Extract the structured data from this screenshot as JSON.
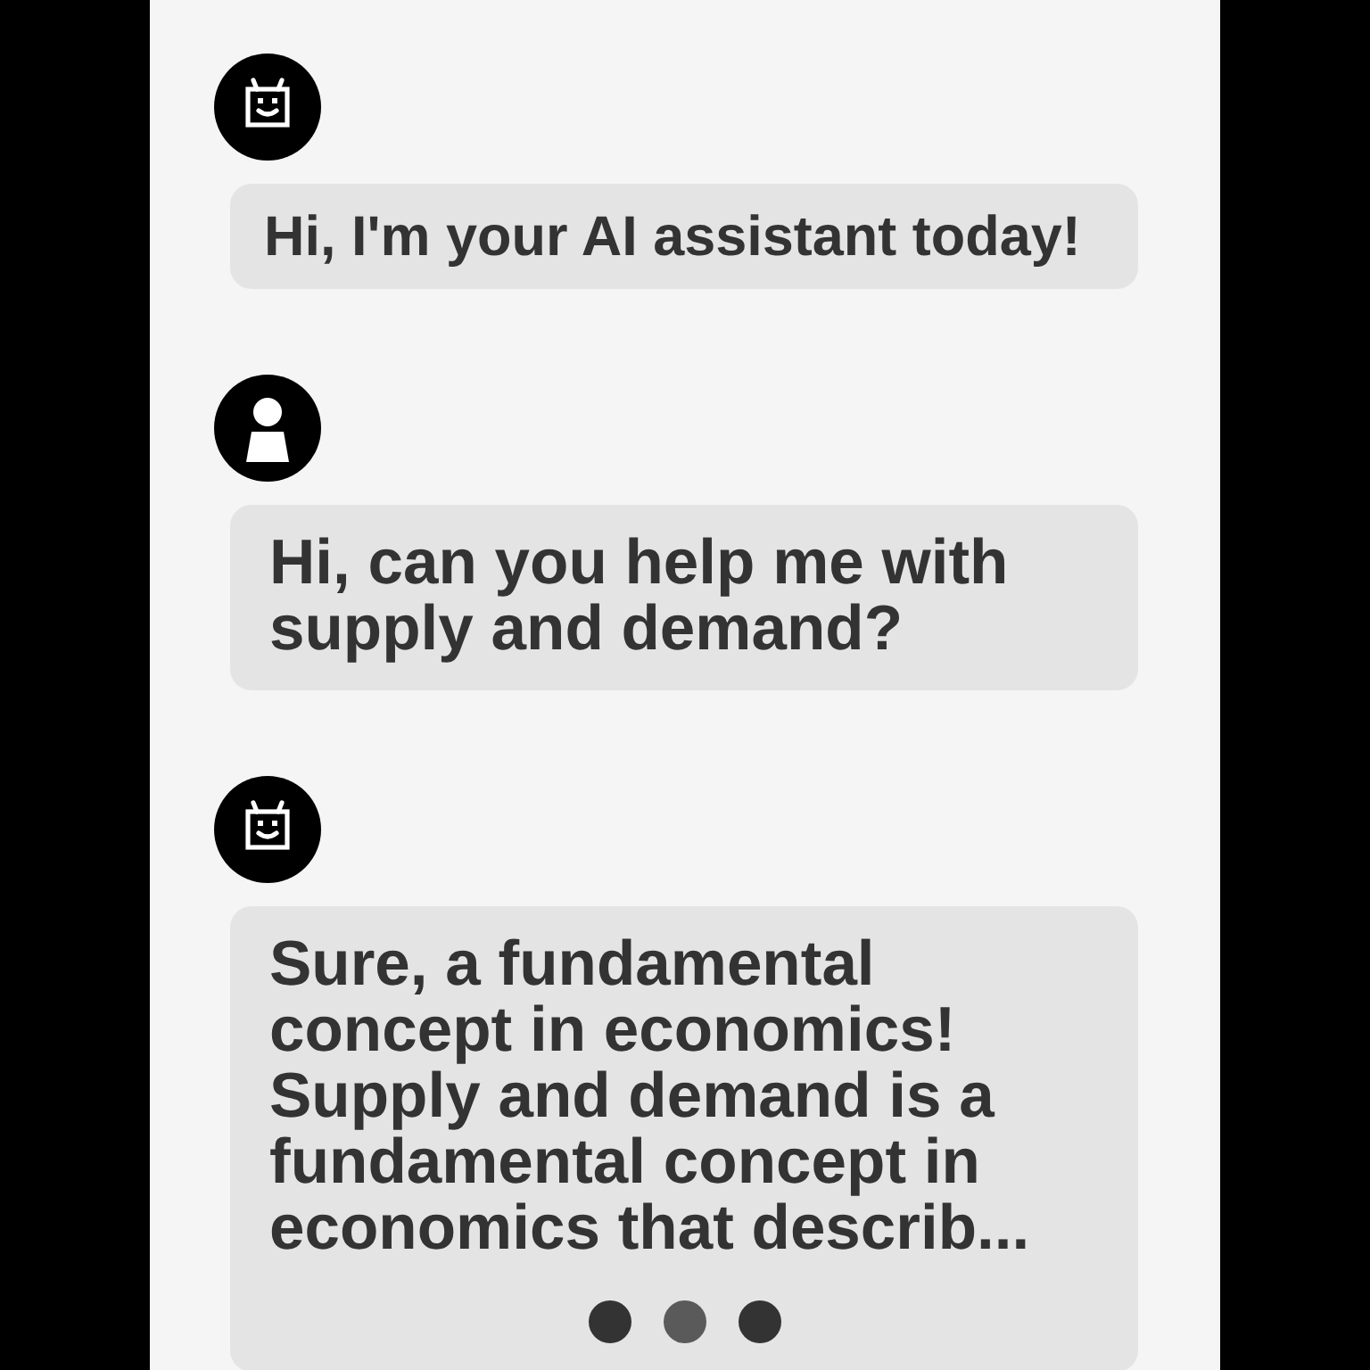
{
  "messages": [
    {
      "kind": "greeting",
      "text": "Hi, I'm your AI assistant today!"
    },
    {
      "kind": "question",
      "text": "Hi, can you help me with supply and demand?"
    },
    {
      "kind": "reply",
      "text": "Sure, a fundamental concept in economics! Supply and demand is a fundamental concept in economics that describ...",
      "typing_dots": [
        {
          "active": false
        },
        {
          "active": true
        },
        {
          "active": false
        }
      ]
    }
  ]
}
